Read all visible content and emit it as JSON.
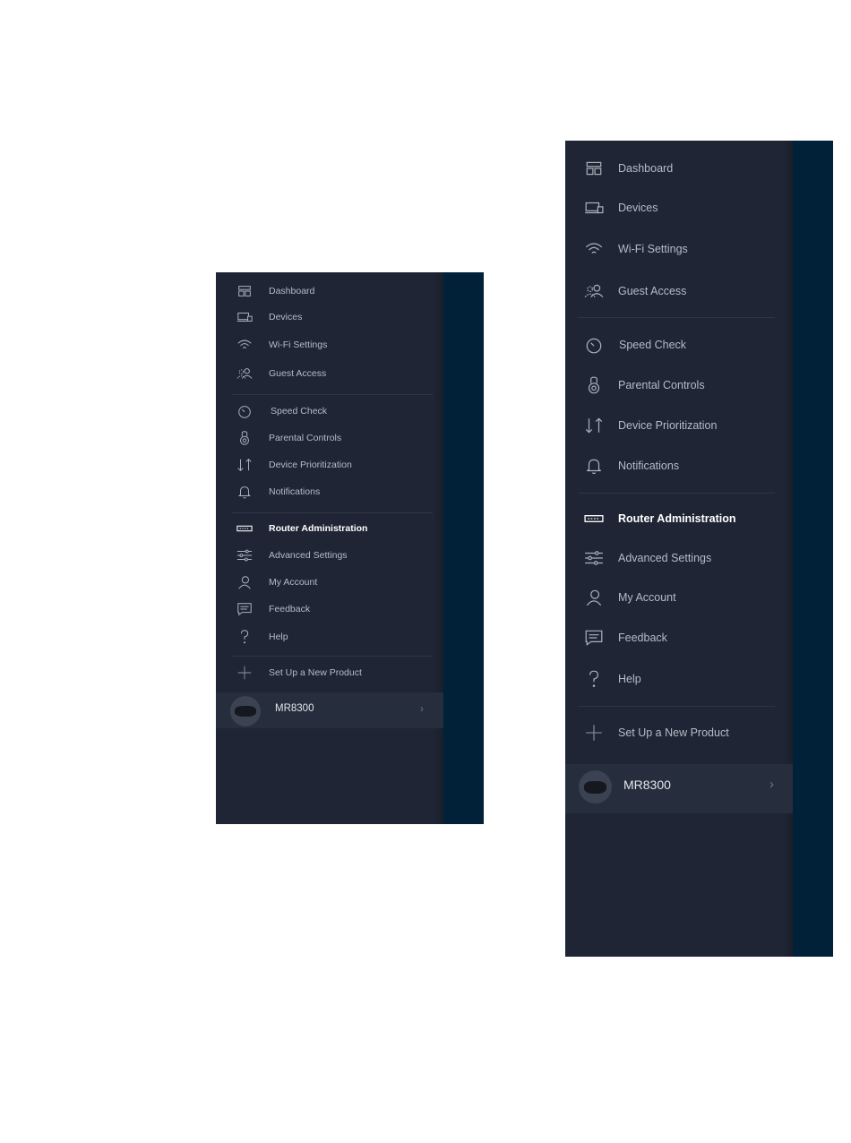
{
  "nav": {
    "group_main": [
      {
        "label": "Dashboard",
        "icon": "dashboard-icon"
      },
      {
        "label": "Devices",
        "icon": "devices-icon"
      },
      {
        "label": "Wi-Fi Settings",
        "icon": "wifi-icon"
      },
      {
        "label": "Guest Access",
        "icon": "guest-access-icon"
      }
    ],
    "group_tools": [
      {
        "label": "Speed Check",
        "icon": "speed-check-icon"
      },
      {
        "label": "Parental Controls",
        "icon": "parental-controls-icon"
      },
      {
        "label": "Device Prioritization",
        "icon": "device-prioritization-icon"
      },
      {
        "label": "Notifications",
        "icon": "notifications-icon"
      }
    ],
    "group_admin": [
      {
        "label": "Router Administration",
        "icon": "router-administration-icon",
        "active": true
      },
      {
        "label": "Advanced Settings",
        "icon": "advanced-settings-icon"
      },
      {
        "label": "My Account",
        "icon": "my-account-icon"
      },
      {
        "label": "Feedback",
        "icon": "feedback-icon"
      },
      {
        "label": "Help",
        "icon": "help-icon"
      }
    ],
    "setup": {
      "label": "Set Up a New Product",
      "icon": "plus-icon"
    }
  },
  "product": {
    "name": "MR8300",
    "icon": "router-device-icon"
  },
  "colors": {
    "menu_bg": "#1f2534",
    "strip_bg": "#002137",
    "text": "#b5bcc6",
    "active_text": "#ffffff"
  }
}
